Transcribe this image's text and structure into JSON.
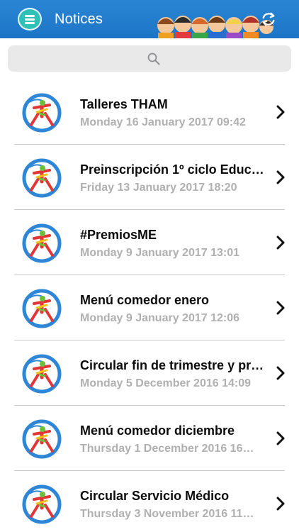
{
  "header": {
    "title": "Notices",
    "menu_icon": "hamburger-menu-icon",
    "refresh_icon": "refresh-icon",
    "colors": {
      "bar": "#1d74c6",
      "menu_button": "#2fc0b6"
    }
  },
  "search": {
    "icon": "search-icon"
  },
  "notices": [
    {
      "title": "Talleres THAM",
      "date": "Monday 16 January 2017 09:42"
    },
    {
      "title": "Preinscripción 1º ciclo Educ…",
      "date": "Friday 13 January 2017 18:20"
    },
    {
      "title": "#PremiosME",
      "date": "Monday 9 January 2017 13:01"
    },
    {
      "title": "Menú comedor enero",
      "date": "Monday 9 January 2017 12:06"
    },
    {
      "title": "Circular fin de trimestre y pr…",
      "date": "Monday 5 December 2016 14:09"
    },
    {
      "title": "Menú comedor diciembre",
      "date": "Thursday 1 December 2016 16…"
    },
    {
      "title": "Circular Servicio Médico",
      "date": "Thursday 3 November 2016 11…"
    }
  ]
}
